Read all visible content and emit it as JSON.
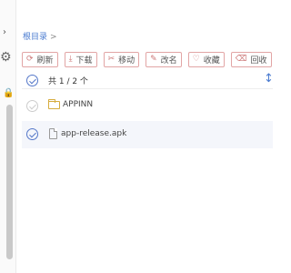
{
  "sidebar": {
    "icons": [
      "chevron-right-icon",
      "gear-icon",
      "lock-icon"
    ]
  },
  "breadcrumb": {
    "root": "根目录",
    "separator": ">"
  },
  "toolbar": {
    "refresh": "刷新",
    "download": "下载",
    "move": "移动",
    "rename": "改名",
    "favorite": "收藏",
    "recycle": "回收"
  },
  "list": {
    "count_text": "共 1 / 2 个",
    "items": [
      {
        "name": "APPINN",
        "type": "folder",
        "selected": false
      },
      {
        "name": "app-release.apk",
        "type": "file",
        "selected": true
      }
    ]
  },
  "colors": {
    "accent": "#4a7bd0",
    "button_border": "#e2a5a5",
    "folder": "#d6ac3d",
    "selected_row": "#f4f6fb"
  }
}
